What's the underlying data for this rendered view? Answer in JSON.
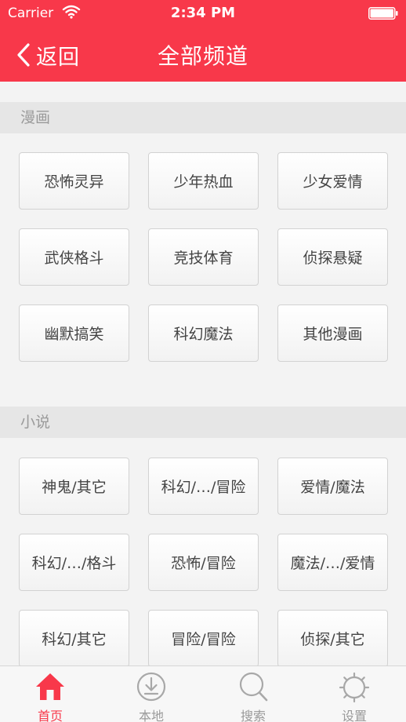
{
  "status_bar": {
    "carrier": "Carrier",
    "time": "2:34 PM"
  },
  "nav": {
    "back_label": "返回",
    "title": "全部频道"
  },
  "sections": [
    {
      "title": "漫画",
      "items": [
        "恐怖灵异",
        "少年热血",
        "少女爱情",
        "武侠格斗",
        "竞技体育",
        "侦探悬疑",
        "幽默搞笑",
        "科幻魔法",
        "其他漫画"
      ]
    },
    {
      "title": "小说",
      "items": [
        "神鬼/其它",
        "科幻/…/冒险",
        "爱情/魔法",
        "科幻/…/格斗",
        "恐怖/冒险",
        "魔法/…/爱情",
        "科幻/其它",
        "冒险/冒险",
        "侦探/其它"
      ]
    }
  ],
  "tabbar": {
    "items": [
      {
        "label": "首页",
        "icon": "home-icon",
        "active": true
      },
      {
        "label": "本地",
        "icon": "download-icon",
        "active": false
      },
      {
        "label": "搜索",
        "icon": "search-icon",
        "active": false
      },
      {
        "label": "设置",
        "icon": "settings-icon",
        "active": false
      }
    ]
  },
  "colors": {
    "accent": "#f8384a",
    "section_bg": "#e6e6e6",
    "page_bg": "#f3f3f3"
  }
}
